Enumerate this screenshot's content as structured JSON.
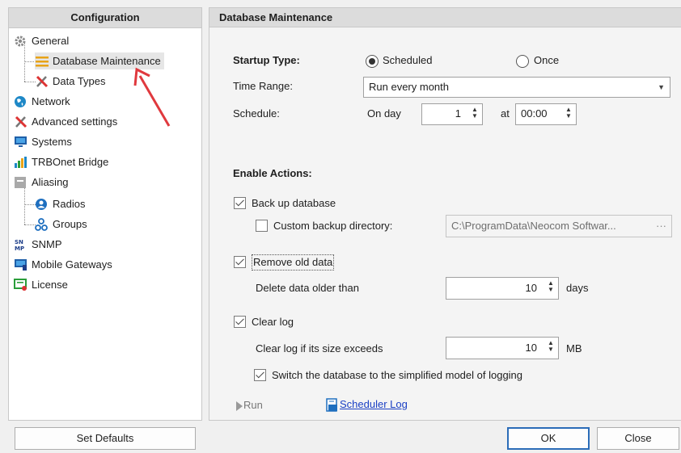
{
  "left_panel": {
    "header": "Configuration",
    "items": [
      {
        "label": "General",
        "icon": "gear-icon"
      },
      {
        "label": "Database Maintenance",
        "icon": "database-maintenance-icon"
      },
      {
        "label": "Data Types",
        "icon": "tools-icon"
      },
      {
        "label": "Network",
        "icon": "globe-icon"
      },
      {
        "label": "Advanced settings",
        "icon": "tools-icon"
      },
      {
        "label": "Systems",
        "icon": "monitor-icon"
      },
      {
        "label": "TRBOnet Bridge",
        "icon": "bars-icon"
      },
      {
        "label": "Aliasing",
        "icon": "list-icon"
      },
      {
        "label": "Radios",
        "icon": "user-icon"
      },
      {
        "label": "Groups",
        "icon": "group-icon"
      },
      {
        "label": "SNMP",
        "icon": "snmp-icon"
      },
      {
        "label": "Mobile Gateways",
        "icon": "mobile-gateway-icon"
      },
      {
        "label": "License",
        "icon": "license-icon"
      }
    ]
  },
  "right_panel": {
    "header": "Database Maintenance",
    "startup_type_label": "Startup Type:",
    "startup_options": {
      "scheduled": "Scheduled",
      "once": "Once",
      "selected": "Scheduled"
    },
    "time_range_label": "Time Range:",
    "time_range_value": "Run every month",
    "schedule_label": "Schedule:",
    "on_day_label": "On day",
    "on_day_value": "1",
    "at_label": "at",
    "at_value": "00:00",
    "enable_actions_label": "Enable Actions:",
    "backup": {
      "label": "Back up database",
      "checked": true
    },
    "custom_backup": {
      "label": "Custom backup directory:",
      "checked": false,
      "path": "C:\\ProgramData\\Neocom Softwar...",
      "browse": "···"
    },
    "remove_old": {
      "label": "Remove old data",
      "checked": true
    },
    "delete_older_label": "Delete data older than",
    "delete_older_value": "10",
    "delete_older_unit": "days",
    "clear_log": {
      "label": "Clear log",
      "checked": true
    },
    "clear_log_size_label": "Clear log if its size exceeds",
    "clear_log_size_value": "10",
    "clear_log_size_unit": "MB",
    "simplified_logging": {
      "label": "Switch the database to the simplified model of logging",
      "checked": true
    },
    "run_label": "Run",
    "scheduler_log_label": "Scheduler Log"
  },
  "footer": {
    "set_defaults": "Set Defaults",
    "ok": "OK",
    "close": "Close"
  },
  "colors": {
    "annotation_arrow": "#e0393e",
    "link": "#1a3fc4",
    "accent": "#2b6cb8"
  }
}
